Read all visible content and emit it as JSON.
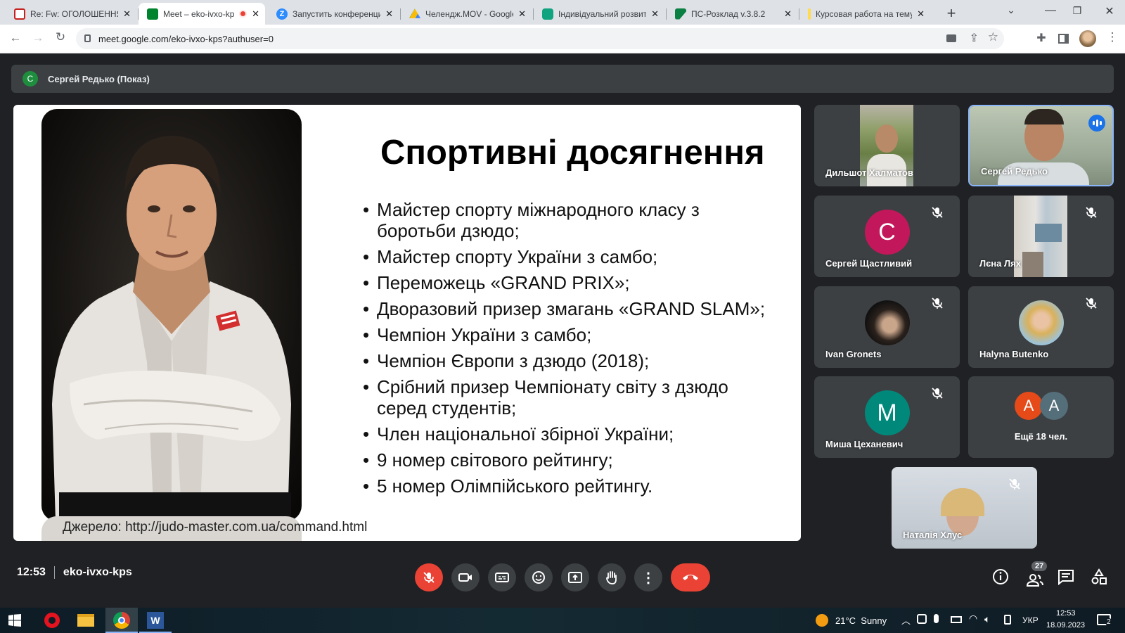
{
  "tabs": [
    {
      "label": "Re: Fw: ОГОЛОШЕННЯ",
      "color": "#c5221f"
    },
    {
      "label": "Meet – eko-ivxo-kps",
      "color": "#00832d"
    },
    {
      "label": "Запустить конференцию",
      "color": "#2d8cff"
    },
    {
      "label": "Челендж.MOV - Google",
      "color": "#fbbc04"
    },
    {
      "label": "Індивідуальний розвиток",
      "color": "#10a37f"
    },
    {
      "label": "ПС-Розклад v.3.8.2",
      "color": "#0b8043"
    },
    {
      "label": "Курсовая работа на тему",
      "color": "#ffdb4d"
    }
  ],
  "address": {
    "url": "meet.google.com/eko-ivxo-kps?authuser=0"
  },
  "presenter": {
    "initial": "С",
    "label": "Сергей Редько (Показ)"
  },
  "slide": {
    "title": "Спортивні досягнення",
    "bullets": [
      "Майстер спорту міжнародного класу з боротьби дзюдо;",
      "Майстер спорту України з самбо;",
      "Переможець «GRAND PRIX»;",
      "Дворазовий призер змагань «GRAND SLAM»;",
      "Чемпіон України з самбо;",
      "Чемпіон Європи з дзюдо (2018);",
      "Срібний призер Чемпіонату світу з дзюдо серед студентів;",
      "Член національної збірної України;",
      "9 номер світового рейтингу;",
      "5 номер Олімпійського рейтингу."
    ],
    "source": "Джерело: http://judo-master.com.ua/command.html"
  },
  "participants": [
    {
      "name": "Дильшот Халматов",
      "type": "video",
      "muted": false
    },
    {
      "name": "Сергей Редько",
      "type": "video",
      "muted": false,
      "speaking": true
    },
    {
      "name": "Сергей Щастливий",
      "type": "avatar",
      "initial": "С",
      "color": "#c2185b",
      "muted": true
    },
    {
      "name": "Лєна Лях",
      "type": "video",
      "muted": true
    },
    {
      "name": "Ivan Gronets",
      "type": "photo",
      "muted": true
    },
    {
      "name": "Halyna Butenko",
      "type": "photo",
      "muted": true
    },
    {
      "name": "Миша Цеханевич",
      "type": "avatar",
      "initial": "М",
      "color": "#00897b",
      "muted": true
    },
    {
      "name": "Наталія Хлус",
      "type": "video",
      "muted": true
    }
  ],
  "more": {
    "label": "Ещё 18 чел.",
    "initials": [
      "А",
      "А"
    ],
    "colors": [
      "#e64a19",
      "#546e7a"
    ]
  },
  "meeting": {
    "time": "12:53",
    "code": "eko-ivxo-kps",
    "people_count": "27"
  },
  "taskbar": {
    "weather": "21°C  Sunny",
    "lang": "УКР",
    "time": "12:53",
    "date": "18.09.2023",
    "notif": "2"
  }
}
